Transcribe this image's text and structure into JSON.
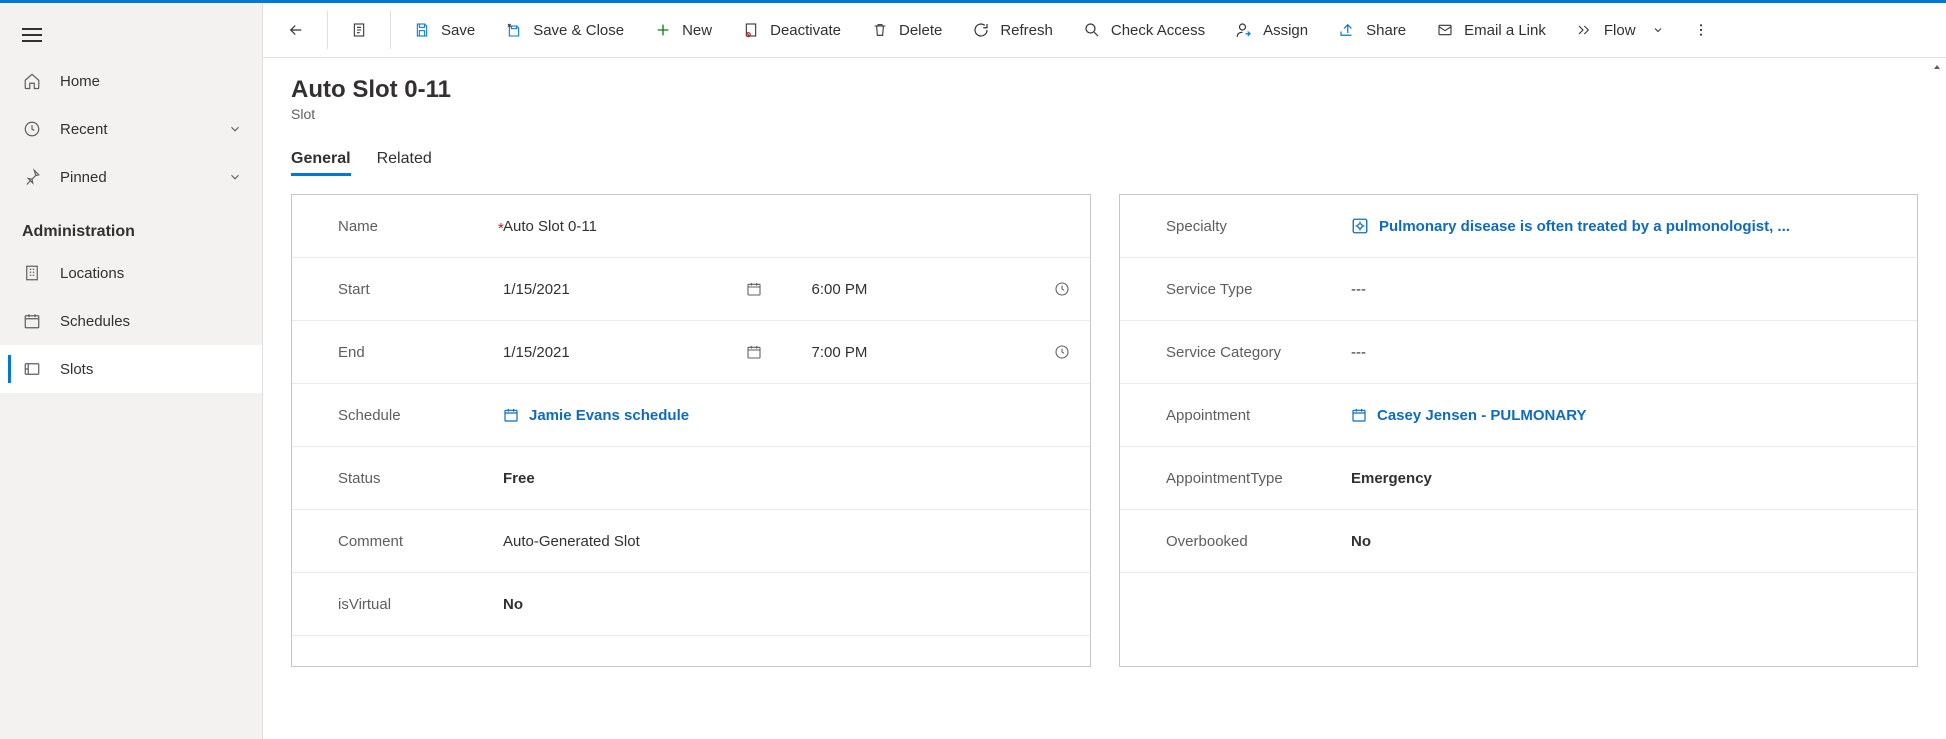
{
  "sidebar": {
    "top": [
      {
        "icon": "home",
        "label": "Home"
      },
      {
        "icon": "clock",
        "label": "Recent",
        "chevron": true
      },
      {
        "icon": "pin",
        "label": "Pinned",
        "chevron": true
      }
    ],
    "section_title": "Administration",
    "items": [
      {
        "icon": "building",
        "label": "Locations"
      },
      {
        "icon": "calendar",
        "label": "Schedules"
      },
      {
        "icon": "slot",
        "label": "Slots",
        "active": true
      }
    ]
  },
  "cmdbar": {
    "back": "",
    "doc": "",
    "save": "Save",
    "save_close": "Save & Close",
    "new": "New",
    "deactivate": "Deactivate",
    "delete": "Delete",
    "refresh": "Refresh",
    "check_access": "Check Access",
    "assign": "Assign",
    "share": "Share",
    "email_link": "Email a Link",
    "flow": "Flow"
  },
  "header": {
    "title": "Auto Slot 0-11",
    "subtitle": "Slot"
  },
  "tabs": {
    "general": "General",
    "related": "Related"
  },
  "left_panel": {
    "name": {
      "label": "Name",
      "value": "Auto Slot 0-11"
    },
    "start": {
      "label": "Start",
      "date": "1/15/2021",
      "time": "6:00 PM"
    },
    "end": {
      "label": "End",
      "date": "1/15/2021",
      "time": "7:00 PM"
    },
    "schedule": {
      "label": "Schedule",
      "link_text": "Jamie Evans schedule"
    },
    "status": {
      "label": "Status",
      "value": "Free"
    },
    "comment": {
      "label": "Comment",
      "value": "Auto-Generated Slot"
    },
    "is_virtual": {
      "label": "isVirtual",
      "value": "No"
    }
  },
  "right_panel": {
    "specialty": {
      "label": "Specialty",
      "link_text": "Pulmonary disease is often treated by a pulmonologist, ..."
    },
    "service_type": {
      "label": "Service Type",
      "value": "---"
    },
    "service_category": {
      "label": "Service Category",
      "value": "---"
    },
    "appointment": {
      "label": "Appointment",
      "link_text": "Casey Jensen - PULMONARY"
    },
    "appointment_type": {
      "label": "AppointmentType",
      "value": "Emergency"
    },
    "overbooked": {
      "label": "Overbooked",
      "value": "No"
    }
  }
}
